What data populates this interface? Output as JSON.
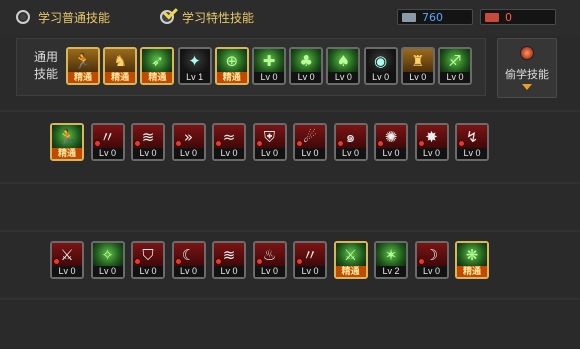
{
  "tabs": [
    {
      "label": "学习普通技能",
      "selected": false
    },
    {
      "label": "学习特性技能",
      "selected": true
    }
  ],
  "currencies": [
    {
      "value": "760",
      "color": "#56a8ff",
      "icon": "ticket-icon"
    },
    {
      "value": "0",
      "color": "#ff5d4a",
      "icon": "ticket-icon"
    }
  ],
  "general_panel": {
    "label": "通用技能"
  },
  "steal_button": {
    "label": "偷学技能",
    "icon": "steal-skill-icon"
  },
  "general_skills": [
    {
      "lv": "精通",
      "mastered": true,
      "icon": "runner-skill-icon",
      "art": "gold",
      "glyph": "🏃"
    },
    {
      "lv": "精通",
      "mastered": true,
      "icon": "kick-skill-icon",
      "art": "gold",
      "glyph": "♞"
    },
    {
      "lv": "精通",
      "mastered": true,
      "icon": "dash-skill-icon",
      "art": "green",
      "glyph": "➶"
    },
    {
      "lv": "Lv 1",
      "mastered": false,
      "icon": "wings-skill-icon",
      "art": "dark",
      "glyph": "✦"
    },
    {
      "lv": "精通",
      "mastered": true,
      "icon": "target-skill-icon",
      "art": "green",
      "glyph": "⊕"
    },
    {
      "lv": "Lv 0",
      "mastered": false,
      "icon": "crosshair-skill-icon",
      "art": "green",
      "glyph": "✚"
    },
    {
      "lv": "Lv 0",
      "mastered": false,
      "icon": "mushroom-skill-icon",
      "art": "green",
      "glyph": "♣"
    },
    {
      "lv": "Lv 0",
      "mastered": false,
      "icon": "figure-skill-icon",
      "art": "green",
      "glyph": "♠"
    },
    {
      "lv": "Lv 0",
      "mastered": false,
      "icon": "eye-skill-icon",
      "art": "dark",
      "glyph": "◉"
    },
    {
      "lv": "Lv 0",
      "mastered": false,
      "icon": "strength-skill-icon",
      "art": "gold",
      "glyph": "♜"
    },
    {
      "lv": "Lv 0",
      "mastered": false,
      "icon": "leap-skill-icon",
      "art": "green",
      "glyph": "♐"
    }
  ],
  "row1_skills": [
    {
      "lv": "精通",
      "mastered": true,
      "icon": "sprint-skill-icon",
      "art": "green",
      "glyph": "🏃"
    },
    {
      "lv": "Lv 0",
      "mastered": false,
      "icon": "slash-skill-icon",
      "art": "red",
      "glyph": "〃"
    },
    {
      "lv": "Lv 0",
      "mastered": false,
      "icon": "claw-skill-icon",
      "art": "red",
      "glyph": "≋"
    },
    {
      "lv": "Lv 0",
      "mastered": false,
      "icon": "arrows-skill-icon",
      "art": "red",
      "glyph": "»"
    },
    {
      "lv": "Lv 0",
      "mastered": false,
      "icon": "wind-skill-icon",
      "art": "red",
      "glyph": "≈"
    },
    {
      "lv": "Lv 0",
      "mastered": false,
      "icon": "shield-skill-icon",
      "art": "red",
      "glyph": "⛨"
    },
    {
      "lv": "Lv 0",
      "mastered": false,
      "icon": "comet-skill-icon",
      "art": "red",
      "glyph": "☄"
    },
    {
      "lv": "Lv 0",
      "mastered": false,
      "icon": "whirl-skill-icon",
      "art": "red",
      "glyph": "๑"
    },
    {
      "lv": "Lv 0",
      "mastered": false,
      "icon": "meteor-skill-icon",
      "art": "red",
      "glyph": "✺"
    },
    {
      "lv": "Lv 0",
      "mastered": false,
      "icon": "spike-skill-icon",
      "art": "red",
      "glyph": "✸"
    },
    {
      "lv": "Lv 0",
      "mastered": false,
      "icon": "swoop-skill-icon",
      "art": "red",
      "glyph": "↯"
    }
  ],
  "row2_skills": [
    {
      "lv": "Lv 0",
      "mastered": false,
      "icon": "warrior-skill-icon",
      "art": "red",
      "glyph": "⚔"
    },
    {
      "lv": "Lv 0",
      "mastered": false,
      "icon": "spark-skill-icon",
      "art": "green",
      "glyph": "✧"
    },
    {
      "lv": "Lv 0",
      "mastered": false,
      "icon": "barrier-skill-icon",
      "art": "red",
      "glyph": "⛉"
    },
    {
      "lv": "Lv 0",
      "mastered": false,
      "icon": "crescent-skill-icon",
      "art": "red",
      "glyph": "☾"
    },
    {
      "lv": "Lv 0",
      "mastered": false,
      "icon": "gust-skill-icon",
      "art": "red",
      "glyph": "≋"
    },
    {
      "lv": "Lv 0",
      "mastered": false,
      "icon": "flame-skill-icon",
      "art": "red",
      "glyph": "♨"
    },
    {
      "lv": "Lv 0",
      "mastered": false,
      "icon": "strike-skill-icon",
      "art": "red",
      "glyph": "〃"
    },
    {
      "lv": "精通",
      "mastered": true,
      "icon": "sword-skill-icon",
      "art": "green",
      "glyph": "⚔"
    },
    {
      "lv": "Lv 2",
      "mastered": false,
      "icon": "vortex-skill-icon",
      "art": "green",
      "glyph": "✶"
    },
    {
      "lv": "Lv 0",
      "mastered": false,
      "icon": "moon-slash-skill-icon",
      "art": "red",
      "glyph": "☽"
    },
    {
      "lv": "精通",
      "mastered": true,
      "icon": "aura-skill-icon",
      "art": "green",
      "glyph": "❋"
    }
  ]
}
